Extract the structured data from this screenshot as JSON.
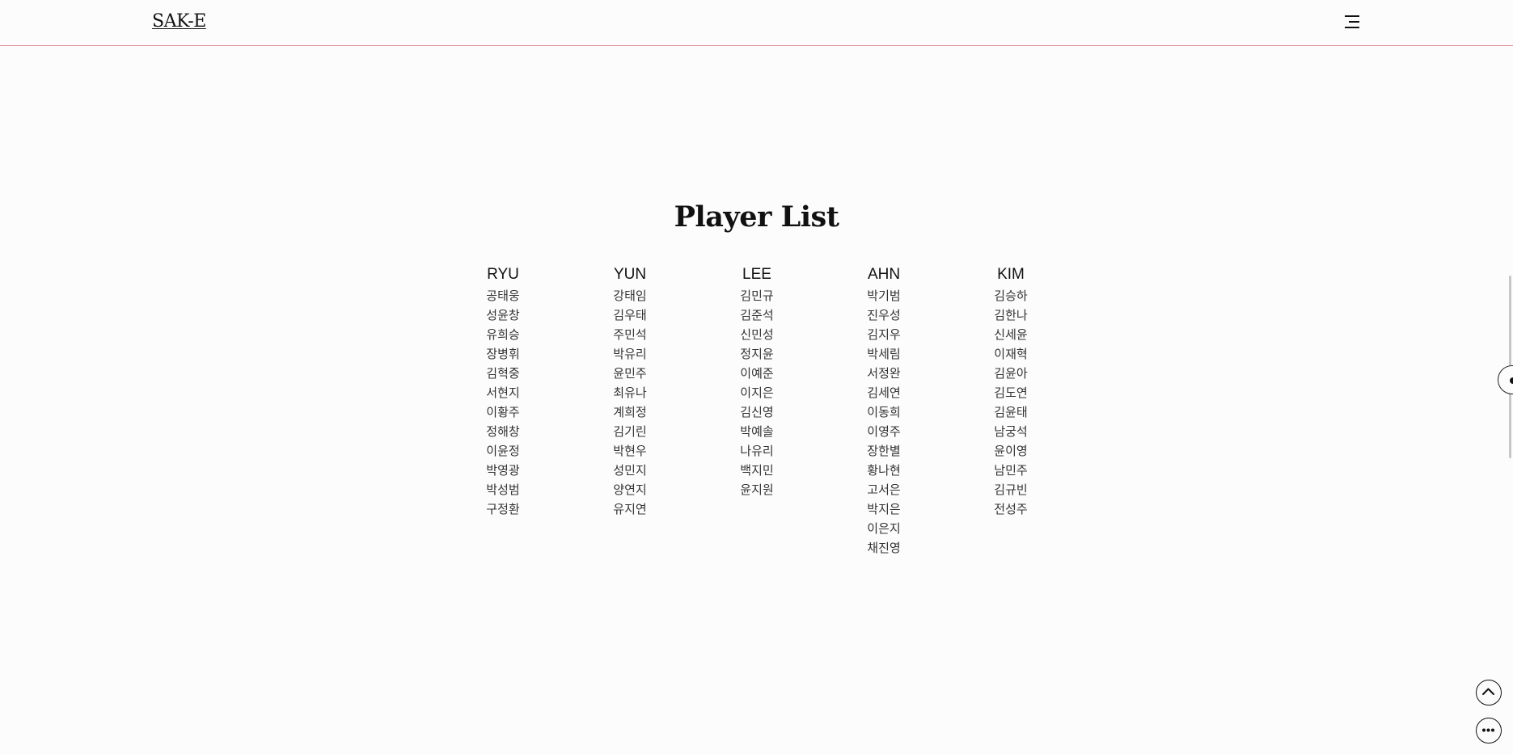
{
  "header": {
    "logo": "SAK-E",
    "menu_icon": "hamburger-menu-icon"
  },
  "main": {
    "title": "Player List",
    "columns": [
      {
        "name": "RYU",
        "players": [
          "공태웅",
          "성윤창",
          "유희승",
          "장병휘",
          "김혁중",
          "서현지",
          "이황주",
          "정해창",
          "이윤정",
          "박영광",
          "박성범",
          "구정환"
        ]
      },
      {
        "name": "YUN",
        "players": [
          "강태임",
          "김우태",
          "주민석",
          "박유리",
          "윤민주",
          "최유나",
          "계희정",
          "김기린",
          "박현우",
          "성민지",
          "양연지",
          "유지연"
        ]
      },
      {
        "name": "LEE",
        "players": [
          "김민규",
          "김준석",
          "신민성",
          "정지윤",
          "이예준",
          "이지은",
          "김신영",
          "박예솔",
          "나유리",
          "백지민",
          "윤지원"
        ]
      },
      {
        "name": "AHN",
        "players": [
          "박기범",
          "진우성",
          "김지우",
          "박세림",
          "서정완",
          "김세연",
          "이동희",
          "이영주",
          "장한별",
          "황나현",
          "고서은",
          "박지은",
          "이은지",
          "채진영"
        ]
      },
      {
        "name": "KIM",
        "players": [
          "김승하",
          "김한나",
          "신세윤",
          "이재혁",
          "김윤아",
          "김도연",
          "김윤태",
          "남궁석",
          "윤이영",
          "남민주",
          "김규빈",
          "전성주"
        ]
      }
    ]
  },
  "floating": {
    "scroll_top_icon": "chevron-up-icon",
    "more_icon": "more-dots-icon",
    "side_tab_icon": "side-tab-icon"
  }
}
